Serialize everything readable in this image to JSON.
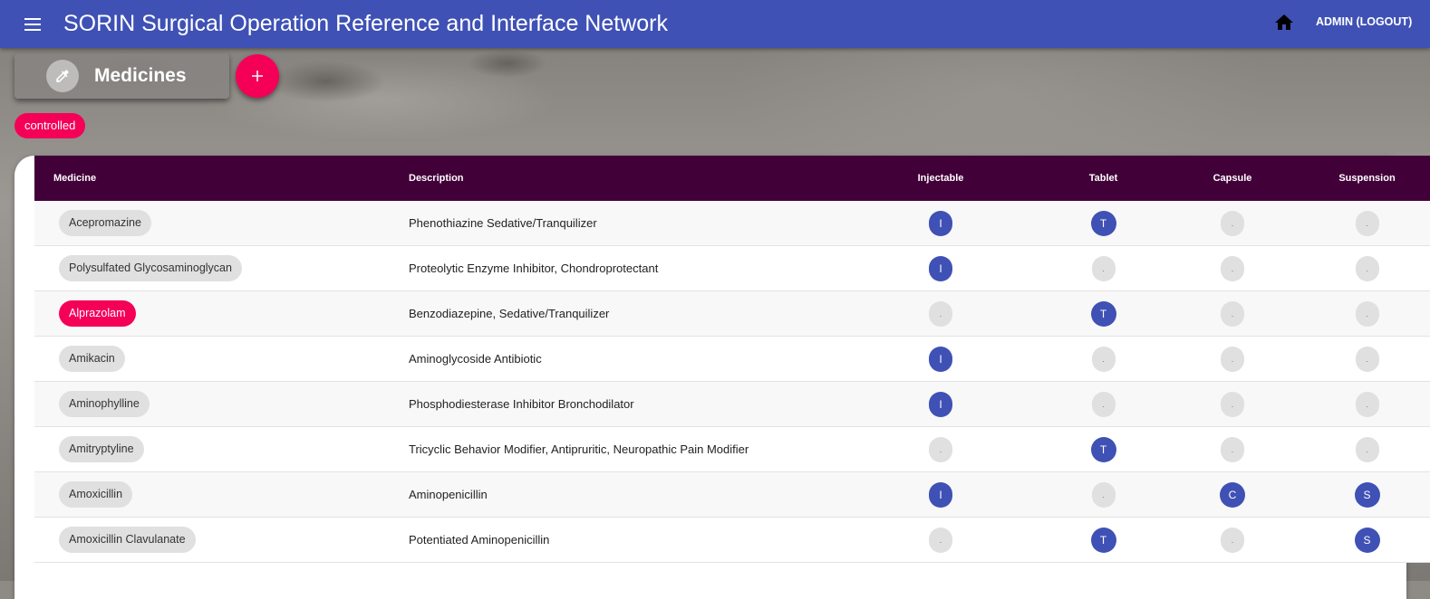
{
  "app": {
    "title": "SORIN Surgical Operation Reference and Interface Network",
    "user_link": "ADMIN (LOGOUT)"
  },
  "icons": {
    "menu": "hamburger-icon",
    "home": "home-icon",
    "page": "eyedropper-icon",
    "add": "plus-icon"
  },
  "colors": {
    "primary": "#3f51b5",
    "accent": "#f50057",
    "table_header": "#420039",
    "chip": "#e0e0e0"
  },
  "page": {
    "title": "Medicines",
    "add_label": "+"
  },
  "filters": [
    "controlled"
  ],
  "table": {
    "columns": [
      "Medicine",
      "Description",
      "Injectable",
      "Tablet",
      "Capsule",
      "Suspension"
    ],
    "empty_marker": ".",
    "rows": [
      {
        "name": "Acepromazine",
        "controlled": false,
        "description": "Phenothiazine Sedative/Tranquilizer",
        "injectable": "I",
        "tablet": "T",
        "capsule": ".",
        "suspension": "."
      },
      {
        "name": "Polysulfated Glycosaminoglycan",
        "controlled": false,
        "description": "Proteolytic Enzyme Inhibitor, Chondroprotectant",
        "injectable": "I",
        "tablet": ".",
        "capsule": ".",
        "suspension": "."
      },
      {
        "name": "Alprazolam",
        "controlled": true,
        "description": "Benzodiazepine, Sedative/Tranquilizer",
        "injectable": ".",
        "tablet": "T",
        "capsule": ".",
        "suspension": "."
      },
      {
        "name": "Amikacin",
        "controlled": false,
        "description": "Aminoglycoside Antibiotic",
        "injectable": "I",
        "tablet": ".",
        "capsule": ".",
        "suspension": "."
      },
      {
        "name": "Aminophylline",
        "controlled": false,
        "description": "Phosphodiesterase Inhibitor Bronchodilator",
        "injectable": "I",
        "tablet": ".",
        "capsule": ".",
        "suspension": "."
      },
      {
        "name": "Amitryptyline",
        "controlled": false,
        "description": "Tricyclic Behavior Modifier, Antipruritic, Neuropathic Pain Modifier",
        "injectable": ".",
        "tablet": "T",
        "capsule": ".",
        "suspension": "."
      },
      {
        "name": "Amoxicillin",
        "controlled": false,
        "description": "Aminopenicillin",
        "injectable": "I",
        "tablet": ".",
        "capsule": "C",
        "suspension": "S"
      },
      {
        "name": "Amoxicillin Clavulanate",
        "controlled": false,
        "description": "Potentiated Aminopenicillin",
        "injectable": ".",
        "tablet": "T",
        "capsule": ".",
        "suspension": "S"
      }
    ]
  }
}
